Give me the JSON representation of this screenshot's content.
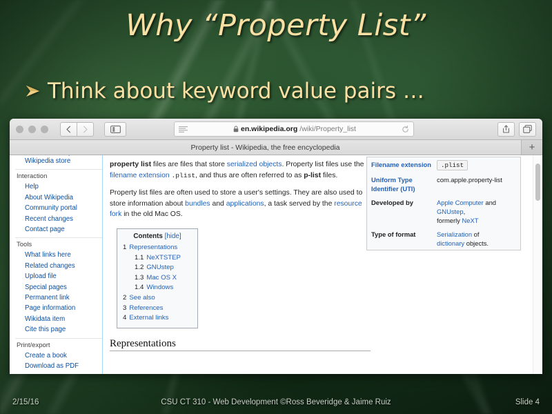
{
  "slide": {
    "title": "Why “Property List”",
    "bullet_icon": "arrow-bullet-icon",
    "bullet_text": "Think about keyword value pairs …",
    "footer": {
      "date": "2/15/16",
      "center": "CSU CT 310 - Web Development ©Ross Beveridge & Jaime Ruiz",
      "slide_number": "Slide 4"
    },
    "colors": {
      "title_text": "#fbe0a4",
      "background_green": "#2c5530",
      "footer_text": "#c8cfc6"
    }
  },
  "browser": {
    "toolbar": {
      "traffic_lights": [
        "close",
        "minimize",
        "zoom"
      ],
      "back_icon": "chevron-left-icon",
      "forward_icon": "chevron-right-icon",
      "sidebar_icon": "sidebar-panel-icon",
      "reader_icon": "reader-view-icon",
      "lock_icon": "lock-icon",
      "url_host": "en.wikipedia.org",
      "url_path": "/wiki/Property_list",
      "reload_icon": "reload-icon",
      "share_icon": "share-icon",
      "tabs_icon": "show-all-tabs-icon"
    },
    "tabbar": {
      "active_tab_title": "Property list - Wikipedia, the free encyclopedia",
      "new_tab_label": "+"
    }
  },
  "wiki": {
    "sidebar": [
      {
        "type": "link",
        "label": "Donate to Wikipedia",
        "clipped": true
      },
      {
        "type": "link",
        "label": "Wikipedia store"
      },
      {
        "type": "head",
        "label": "Interaction"
      },
      {
        "type": "link",
        "label": "Help"
      },
      {
        "type": "link",
        "label": "About Wikipedia"
      },
      {
        "type": "link",
        "label": "Community portal"
      },
      {
        "type": "link",
        "label": "Recent changes"
      },
      {
        "type": "link",
        "label": "Contact page"
      },
      {
        "type": "head",
        "label": "Tools"
      },
      {
        "type": "link",
        "label": "What links here"
      },
      {
        "type": "link",
        "label": "Related changes"
      },
      {
        "type": "link",
        "label": "Upload file"
      },
      {
        "type": "link",
        "label": "Special pages"
      },
      {
        "type": "link",
        "label": "Permanent link"
      },
      {
        "type": "link",
        "label": "Page information"
      },
      {
        "type": "link",
        "label": "Wikidata item"
      },
      {
        "type": "link",
        "label": "Cite this page"
      },
      {
        "type": "head",
        "label": "Print/export"
      },
      {
        "type": "link",
        "label": "Create a book"
      },
      {
        "type": "link",
        "label": "Download as PDF"
      }
    ],
    "article": {
      "paragraph1": {
        "lead_bold": "property list",
        "t1": " files are files that store ",
        "link1": "serialized objects",
        "t2": ". Property list files use the ",
        "link2": "filename extension",
        "code1": ".plist",
        "t3": ", and thus are often referred to as ",
        "bold2": "p-list",
        "t4": " files."
      },
      "paragraph2": {
        "t1": "Property list files are often used to store a user's settings. They are also used to store information about ",
        "link1": "bundles",
        "t2": " and ",
        "link2": "applications",
        "t3": ", a task served by the ",
        "link3": "resource fork",
        "t4": " in the old Mac OS."
      },
      "heading_clipped": "Representations"
    },
    "toc": {
      "title": "Contents",
      "toggle": "[hide]",
      "items": [
        {
          "num": "1",
          "label": "Representations",
          "level": 1
        },
        {
          "num": "1.1",
          "label": "NeXTSTEP",
          "level": 2
        },
        {
          "num": "1.2",
          "label": "GNUstep",
          "level": 2
        },
        {
          "num": "1.3",
          "label": "Mac OS X",
          "level": 2
        },
        {
          "num": "1.4",
          "label": "Windows",
          "level": 2
        },
        {
          "num": "2",
          "label": "See also",
          "level": 1
        },
        {
          "num": "3",
          "label": "References",
          "level": 1
        },
        {
          "num": "4",
          "label": "External links",
          "level": 1
        }
      ]
    },
    "infobox": {
      "rows": [
        {
          "label": "Filename extension",
          "label_is_link": true,
          "value_chip": ".plist"
        },
        {
          "label": "Uniform Type Identifier (UTI)",
          "label_is_link": true,
          "value_text": "com.apple.property-list"
        },
        {
          "label": "Developed by",
          "label_is_link": false,
          "value_parts": [
            "Apple Computer",
            " and ",
            "GNUstep",
            ",",
            "formerly ",
            "NeXT"
          ]
        },
        {
          "label": "Type of format",
          "label_is_link": false,
          "value_parts2": [
            "Serialization",
            " of ",
            "dictionary",
            " objects."
          ]
        }
      ]
    }
  }
}
